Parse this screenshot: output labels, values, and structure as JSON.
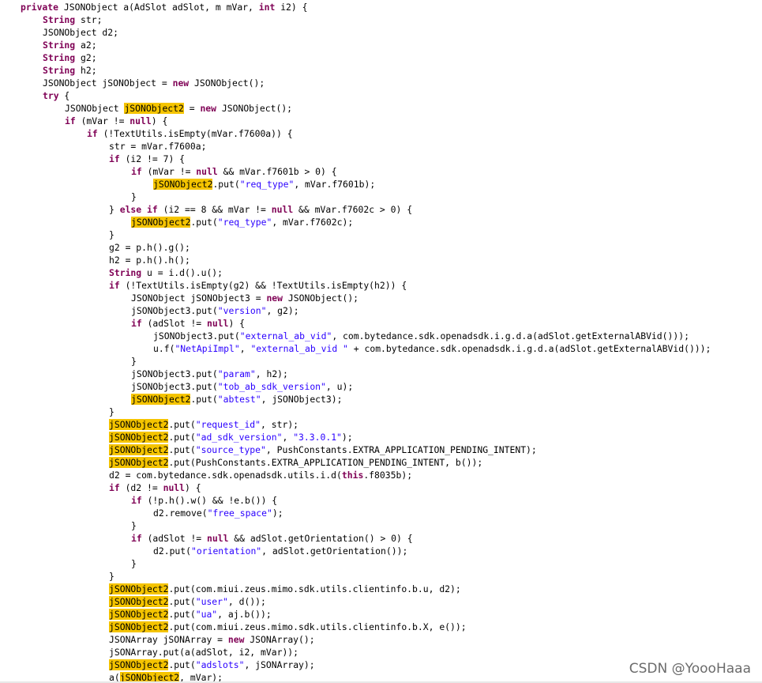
{
  "colors": {
    "keyword": "#7f0055",
    "string": "#2a00ff",
    "plain": "#000000",
    "highlight": "#f5c400",
    "watermark": "#6b6b6b"
  },
  "code_lines": [
    {
      "indent": 0,
      "tokens": [
        {
          "t": "kw",
          "v": "private "
        },
        {
          "t": "pl",
          "v": "JSONObject a(AdSlot adSlot, m mVar, "
        },
        {
          "t": "kw",
          "v": "int"
        },
        {
          "t": "pl",
          "v": " i2) {"
        }
      ]
    },
    {
      "indent": 1,
      "tokens": [
        {
          "t": "kw",
          "v": "String"
        },
        {
          "t": "pl",
          "v": " str;"
        }
      ]
    },
    {
      "indent": 1,
      "tokens": [
        {
          "t": "pl",
          "v": "JSONObject d2;"
        }
      ]
    },
    {
      "indent": 1,
      "tokens": [
        {
          "t": "kw",
          "v": "String"
        },
        {
          "t": "pl",
          "v": " a2;"
        }
      ]
    },
    {
      "indent": 1,
      "tokens": [
        {
          "t": "kw",
          "v": "String"
        },
        {
          "t": "pl",
          "v": " g2;"
        }
      ]
    },
    {
      "indent": 1,
      "tokens": [
        {
          "t": "kw",
          "v": "String"
        },
        {
          "t": "pl",
          "v": " h2;"
        }
      ]
    },
    {
      "indent": 1,
      "tokens": [
        {
          "t": "pl",
          "v": "JSONObject jSONObject = "
        },
        {
          "t": "kw",
          "v": "new"
        },
        {
          "t": "pl",
          "v": " JSONObject();"
        }
      ]
    },
    {
      "indent": 1,
      "tokens": [
        {
          "t": "kw",
          "v": "try"
        },
        {
          "t": "pl",
          "v": " {"
        }
      ]
    },
    {
      "indent": 2,
      "tokens": [
        {
          "t": "pl",
          "v": "JSONObject "
        },
        {
          "t": "hl",
          "v": "jSONObject2"
        },
        {
          "t": "pl",
          "v": " = "
        },
        {
          "t": "kw",
          "v": "new"
        },
        {
          "t": "pl",
          "v": " JSONObject();"
        }
      ]
    },
    {
      "indent": 2,
      "tokens": [
        {
          "t": "kw",
          "v": "if"
        },
        {
          "t": "pl",
          "v": " (mVar != "
        },
        {
          "t": "kw",
          "v": "null"
        },
        {
          "t": "pl",
          "v": ") {"
        }
      ]
    },
    {
      "indent": 3,
      "tokens": [
        {
          "t": "kw",
          "v": "if"
        },
        {
          "t": "pl",
          "v": " (!TextUtils.isEmpty(mVar.f7600a)) {"
        }
      ]
    },
    {
      "indent": 4,
      "tokens": [
        {
          "t": "pl",
          "v": "str = mVar.f7600a;"
        }
      ]
    },
    {
      "indent": 4,
      "tokens": [
        {
          "t": "kw",
          "v": "if"
        },
        {
          "t": "pl",
          "v": " (i2 != 7) {"
        }
      ]
    },
    {
      "indent": 5,
      "tokens": [
        {
          "t": "kw",
          "v": "if"
        },
        {
          "t": "pl",
          "v": " (mVar != "
        },
        {
          "t": "kw",
          "v": "null"
        },
        {
          "t": "pl",
          "v": " && mVar.f7601b > 0) {"
        }
      ]
    },
    {
      "indent": 6,
      "tokens": [
        {
          "t": "hl",
          "v": "jSONObject2"
        },
        {
          "t": "pl",
          "v": ".put("
        },
        {
          "t": "str",
          "v": "\"req_type\""
        },
        {
          "t": "pl",
          "v": ", mVar.f7601b);"
        }
      ]
    },
    {
      "indent": 5,
      "tokens": [
        {
          "t": "pl",
          "v": "}"
        }
      ]
    },
    {
      "indent": 4,
      "tokens": [
        {
          "t": "pl",
          "v": "} "
        },
        {
          "t": "kw",
          "v": "else if"
        },
        {
          "t": "pl",
          "v": " (i2 == 8 && mVar != "
        },
        {
          "t": "kw",
          "v": "null"
        },
        {
          "t": "pl",
          "v": " && mVar.f7602c > 0) {"
        }
      ]
    },
    {
      "indent": 5,
      "tokens": [
        {
          "t": "hl",
          "v": "jSONObject2"
        },
        {
          "t": "pl",
          "v": ".put("
        },
        {
          "t": "str",
          "v": "\"req_type\""
        },
        {
          "t": "pl",
          "v": ", mVar.f7602c);"
        }
      ]
    },
    {
      "indent": 4,
      "tokens": [
        {
          "t": "pl",
          "v": "}"
        }
      ]
    },
    {
      "indent": 4,
      "tokens": [
        {
          "t": "pl",
          "v": "g2 = p.h().g();"
        }
      ]
    },
    {
      "indent": 4,
      "tokens": [
        {
          "t": "pl",
          "v": "h2 = p.h().h();"
        }
      ]
    },
    {
      "indent": 4,
      "tokens": [
        {
          "t": "kw",
          "v": "String"
        },
        {
          "t": "pl",
          "v": " u = i.d().u();"
        }
      ]
    },
    {
      "indent": 4,
      "tokens": [
        {
          "t": "kw",
          "v": "if"
        },
        {
          "t": "pl",
          "v": " (!TextUtils.isEmpty(g2) && !TextUtils.isEmpty(h2)) {"
        }
      ]
    },
    {
      "indent": 5,
      "tokens": [
        {
          "t": "pl",
          "v": "JSONObject jSONObject3 = "
        },
        {
          "t": "kw",
          "v": "new"
        },
        {
          "t": "pl",
          "v": " JSONObject();"
        }
      ]
    },
    {
      "indent": 5,
      "tokens": [
        {
          "t": "pl",
          "v": "jSONObject3.put("
        },
        {
          "t": "str",
          "v": "\"version\""
        },
        {
          "t": "pl",
          "v": ", g2);"
        }
      ]
    },
    {
      "indent": 5,
      "tokens": [
        {
          "t": "kw",
          "v": "if"
        },
        {
          "t": "pl",
          "v": " (adSlot != "
        },
        {
          "t": "kw",
          "v": "null"
        },
        {
          "t": "pl",
          "v": ") {"
        }
      ]
    },
    {
      "indent": 6,
      "tokens": [
        {
          "t": "pl",
          "v": "jSONObject3.put("
        },
        {
          "t": "str",
          "v": "\"external_ab_vid\""
        },
        {
          "t": "pl",
          "v": ", com.bytedance.sdk.openadsdk.i.g.d.a(adSlot.getExternalABVid()));"
        }
      ]
    },
    {
      "indent": 6,
      "tokens": [
        {
          "t": "pl",
          "v": "u.f("
        },
        {
          "t": "str",
          "v": "\"NetApiImpl\""
        },
        {
          "t": "pl",
          "v": ", "
        },
        {
          "t": "str",
          "v": "\"external_ab_vid \""
        },
        {
          "t": "pl",
          "v": " + com.bytedance.sdk.openadsdk.i.g.d.a(adSlot.getExternalABVid()));"
        }
      ]
    },
    {
      "indent": 5,
      "tokens": [
        {
          "t": "pl",
          "v": "}"
        }
      ]
    },
    {
      "indent": 5,
      "tokens": [
        {
          "t": "pl",
          "v": "jSONObject3.put("
        },
        {
          "t": "str",
          "v": "\"param\""
        },
        {
          "t": "pl",
          "v": ", h2);"
        }
      ]
    },
    {
      "indent": 5,
      "tokens": [
        {
          "t": "pl",
          "v": "jSONObject3.put("
        },
        {
          "t": "str",
          "v": "\"tob_ab_sdk_version\""
        },
        {
          "t": "pl",
          "v": ", u);"
        }
      ]
    },
    {
      "indent": 5,
      "tokens": [
        {
          "t": "hl",
          "v": "jSONObject2"
        },
        {
          "t": "pl",
          "v": ".put("
        },
        {
          "t": "str",
          "v": "\"abtest\""
        },
        {
          "t": "pl",
          "v": ", jSONObject3);"
        }
      ]
    },
    {
      "indent": 4,
      "tokens": [
        {
          "t": "pl",
          "v": "}"
        }
      ]
    },
    {
      "indent": 4,
      "tokens": [
        {
          "t": "hl",
          "v": "jSONObject2"
        },
        {
          "t": "pl",
          "v": ".put("
        },
        {
          "t": "str",
          "v": "\"request_id\""
        },
        {
          "t": "pl",
          "v": ", str);"
        }
      ]
    },
    {
      "indent": 4,
      "tokens": [
        {
          "t": "hl",
          "v": "jSONObject2"
        },
        {
          "t": "pl",
          "v": ".put("
        },
        {
          "t": "str",
          "v": "\"ad_sdk_version\""
        },
        {
          "t": "pl",
          "v": ", "
        },
        {
          "t": "str",
          "v": "\"3.3.0.1\""
        },
        {
          "t": "pl",
          "v": ");"
        }
      ]
    },
    {
      "indent": 4,
      "tokens": [
        {
          "t": "hl",
          "v": "jSONObject2"
        },
        {
          "t": "pl",
          "v": ".put("
        },
        {
          "t": "str",
          "v": "\"source_type\""
        },
        {
          "t": "pl",
          "v": ", PushConstants.EXTRA_APPLICATION_PENDING_INTENT);"
        }
      ]
    },
    {
      "indent": 4,
      "tokens": [
        {
          "t": "hl",
          "v": "jSONObject2"
        },
        {
          "t": "pl",
          "v": ".put(PushConstants.EXTRA_APPLICATION_PENDING_INTENT, b());"
        }
      ]
    },
    {
      "indent": 4,
      "tokens": [
        {
          "t": "pl",
          "v": "d2 = com.bytedance.sdk.openadsdk.utils.i.d("
        },
        {
          "t": "kw",
          "v": "this"
        },
        {
          "t": "pl",
          "v": ".f8035b);"
        }
      ]
    },
    {
      "indent": 4,
      "tokens": [
        {
          "t": "kw",
          "v": "if"
        },
        {
          "t": "pl",
          "v": " (d2 != "
        },
        {
          "t": "kw",
          "v": "null"
        },
        {
          "t": "pl",
          "v": ") {"
        }
      ]
    },
    {
      "indent": 5,
      "tokens": [
        {
          "t": "kw",
          "v": "if"
        },
        {
          "t": "pl",
          "v": " (!p.h().w() && !e.b()) {"
        }
      ]
    },
    {
      "indent": 6,
      "tokens": [
        {
          "t": "pl",
          "v": "d2.remove("
        },
        {
          "t": "str",
          "v": "\"free_space\""
        },
        {
          "t": "pl",
          "v": ");"
        }
      ]
    },
    {
      "indent": 5,
      "tokens": [
        {
          "t": "pl",
          "v": "}"
        }
      ]
    },
    {
      "indent": 5,
      "tokens": [
        {
          "t": "kw",
          "v": "if"
        },
        {
          "t": "pl",
          "v": " (adSlot != "
        },
        {
          "t": "kw",
          "v": "null"
        },
        {
          "t": "pl",
          "v": " && adSlot.getOrientation() > 0) {"
        }
      ]
    },
    {
      "indent": 6,
      "tokens": [
        {
          "t": "pl",
          "v": "d2.put("
        },
        {
          "t": "str",
          "v": "\"orientation\""
        },
        {
          "t": "pl",
          "v": ", adSlot.getOrientation());"
        }
      ]
    },
    {
      "indent": 5,
      "tokens": [
        {
          "t": "pl",
          "v": "}"
        }
      ]
    },
    {
      "indent": 4,
      "tokens": [
        {
          "t": "pl",
          "v": "}"
        }
      ]
    },
    {
      "indent": 4,
      "tokens": [
        {
          "t": "hl",
          "v": "jSONObject2"
        },
        {
          "t": "pl",
          "v": ".put(com.miui.zeus.mimo.sdk.utils.clientinfo.b.u, d2);"
        }
      ]
    },
    {
      "indent": 4,
      "tokens": [
        {
          "t": "hl",
          "v": "jSONObject2"
        },
        {
          "t": "pl",
          "v": ".put("
        },
        {
          "t": "str",
          "v": "\"user\""
        },
        {
          "t": "pl",
          "v": ", d());"
        }
      ]
    },
    {
      "indent": 4,
      "tokens": [
        {
          "t": "hl",
          "v": "jSONObject2"
        },
        {
          "t": "pl",
          "v": ".put("
        },
        {
          "t": "str",
          "v": "\"ua\""
        },
        {
          "t": "pl",
          "v": ", aj.b());"
        }
      ]
    },
    {
      "indent": 4,
      "tokens": [
        {
          "t": "hl",
          "v": "jSONObject2"
        },
        {
          "t": "pl",
          "v": ".put(com.miui.zeus.mimo.sdk.utils.clientinfo.b.X, e());"
        }
      ]
    },
    {
      "indent": 4,
      "tokens": [
        {
          "t": "pl",
          "v": "JSONArray jSONArray = "
        },
        {
          "t": "kw",
          "v": "new"
        },
        {
          "t": "pl",
          "v": " JSONArray();"
        }
      ]
    },
    {
      "indent": 4,
      "tokens": [
        {
          "t": "pl",
          "v": "jSONArray.put(a(adSlot, i2, mVar));"
        }
      ]
    },
    {
      "indent": 4,
      "tokens": [
        {
          "t": "hl",
          "v": "jSONObject2"
        },
        {
          "t": "pl",
          "v": ".put("
        },
        {
          "t": "str",
          "v": "\"adslots\""
        },
        {
          "t": "pl",
          "v": ", jSONArray);"
        }
      ]
    },
    {
      "indent": 4,
      "tokens": [
        {
          "t": "pl",
          "v": "a("
        },
        {
          "t": "hl",
          "v": "jSONObject2"
        },
        {
          "t": "pl",
          "v": ", mVar);"
        }
      ]
    }
  ],
  "watermark": "CSDN @YoooHaaa"
}
